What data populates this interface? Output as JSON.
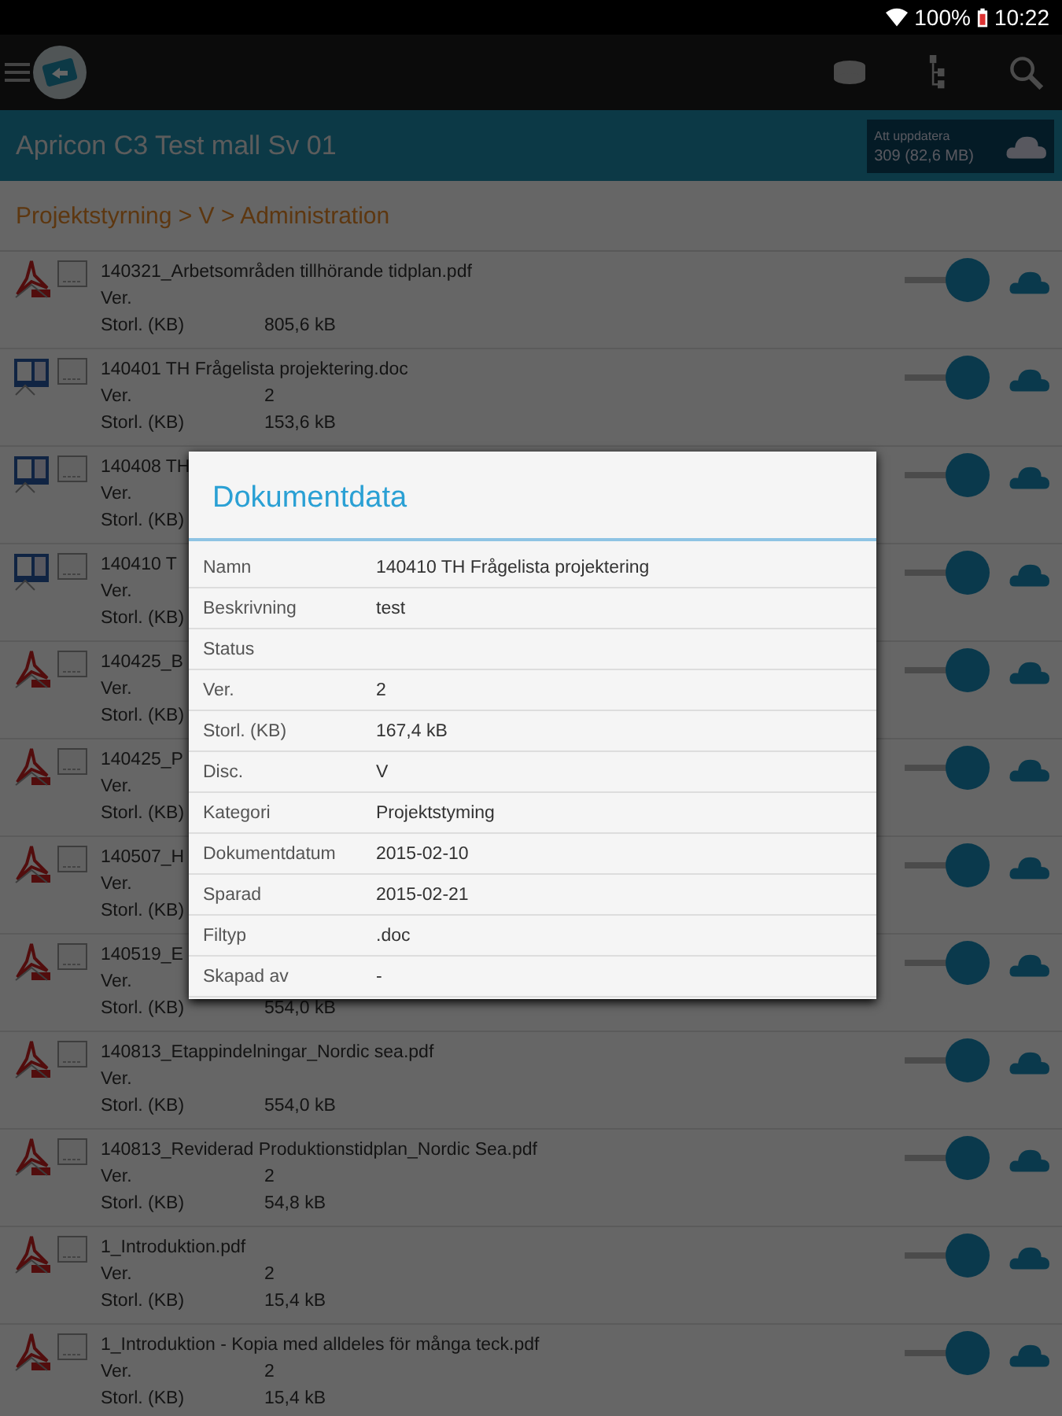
{
  "status_bar": {
    "battery": "100%",
    "time": "10:22"
  },
  "project": {
    "title": "Apricon C3 Test mall Sv 01",
    "update_label": "Att uppdatera",
    "update_count": "309 (82,6 MB)"
  },
  "breadcrumb": "Projektstyrning > V > Administration",
  "documents": [
    {
      "kind": "pdf",
      "name": "140321_Arbetsområden tillhörande tidplan.pdf",
      "version_label": "Ver.",
      "size_label": "Storl. (KB)",
      "size": "805,6 kB",
      "on": true
    },
    {
      "kind": "word",
      "name": "140401 TH Frågelista projektering.doc",
      "version_label": "Ver.",
      "version": "2",
      "size_label": "Storl. (KB)",
      "size": "153,6 kB",
      "on": true
    },
    {
      "kind": "word",
      "name": "140408 TH",
      "version_label": "Ver.",
      "size_label": "Storl. (KB)",
      "on": true
    },
    {
      "kind": "word",
      "name": "140410 T",
      "version_label": "Ver.",
      "size_label": "Storl. (KB)",
      "on": true
    },
    {
      "kind": "pdf",
      "name": "140425_B",
      "version_label": "Ver.",
      "size_label": "Storl. (KB)",
      "on": true
    },
    {
      "kind": "pdf",
      "name": "140425_P",
      "version_label": "Ver.",
      "size_label": "Storl. (KB)",
      "on": true
    },
    {
      "kind": "pdf",
      "name": "140507_H",
      "version_label": "Ver.",
      "size_label": "Storl. (KB)",
      "on": true
    },
    {
      "kind": "pdf",
      "name": "140519_E",
      "version_label": "Ver.",
      "size_label": "Storl. (KB)",
      "size": "554,0 kB",
      "on": true
    },
    {
      "kind": "pdf",
      "name": "140813_Etappindelningar_Nordic sea.pdf",
      "version_label": "Ver.",
      "size_label": "Storl. (KB)",
      "size": "554,0 kB",
      "on": true
    },
    {
      "kind": "pdf",
      "name": "140813_Reviderad Produktionstidplan_Nordic Sea.pdf",
      "version_label": "Ver.",
      "version": "2",
      "size_label": "Storl. (KB)",
      "size": "54,8 kB",
      "on": true
    },
    {
      "kind": "pdf",
      "name": "1_Introduktion.pdf",
      "version_label": "Ver.",
      "version": "2",
      "size_label": "Storl. (KB)",
      "size": "15,4 kB",
      "on": true
    },
    {
      "kind": "pdf",
      "name": "1_Introduktion - Kopia med alldeles för många teck.pdf",
      "version_label": "Ver.",
      "version": "2",
      "size_label": "Storl. (KB)",
      "size": "15,4 kB",
      "on": true
    }
  ],
  "dialog": {
    "title": "Dokumentdata",
    "fields": [
      {
        "label": "Namn",
        "value": "140410 TH Frågelista projektering"
      },
      {
        "label": "Beskrivning",
        "value": "test"
      },
      {
        "label": "Status"
      },
      {
        "label": "Ver.",
        "value": "2"
      },
      {
        "label": "Storl. (KB)",
        "value": "167,4 kB"
      },
      {
        "label": "Disc.",
        "value": "V"
      },
      {
        "label": "Kategori",
        "value": "Projektstyming"
      },
      {
        "label": "Dokumentdatum",
        "value": "2015-02-10"
      },
      {
        "label": "Sparad",
        "value": "2015-02-21"
      },
      {
        "label": "Filtyp",
        "value": ".doc"
      },
      {
        "label": "Skapad av",
        "value": "-"
      }
    ]
  }
}
